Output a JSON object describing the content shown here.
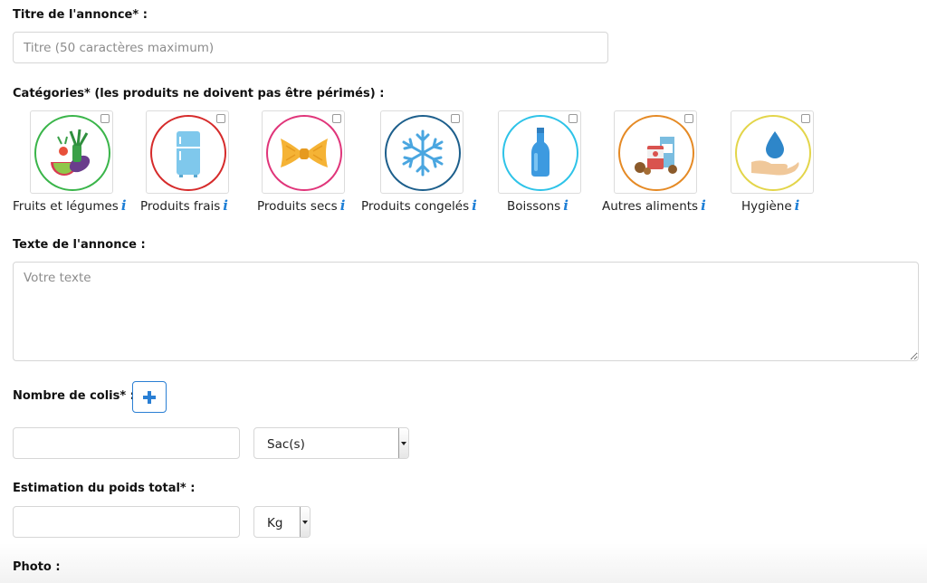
{
  "title_section": {
    "label": "Titre de l'annonce* :",
    "placeholder": "Titre (50 caractères maximum)",
    "value": ""
  },
  "categories_section": {
    "label": "Catégories* (les produits ne doivent pas être périmés) :",
    "items": [
      {
        "label": "Fruits et légumes",
        "icon": "vegetables-icon",
        "ring_color": "#3ab54a",
        "checked": false
      },
      {
        "label": "Produits frais",
        "icon": "fridge-icon",
        "ring_color": "#d62b2b",
        "checked": false
      },
      {
        "label": "Produits secs",
        "icon": "pasta-icon",
        "ring_color": "#e0357a",
        "checked": false
      },
      {
        "label": "Produits congelés",
        "icon": "snowflake-icon",
        "ring_color": "#1d5f8c",
        "checked": false
      },
      {
        "label": "Boissons",
        "icon": "bottle-icon",
        "ring_color": "#2ec3e8",
        "checked": false
      },
      {
        "label": "Autres aliments",
        "icon": "canned-food-icon",
        "ring_color": "#e58a25",
        "checked": false
      },
      {
        "label": "Hygiène",
        "icon": "water-drop-hand-icon",
        "ring_color": "#e3d54a",
        "checked": false
      }
    ],
    "info_icon": "info-icon",
    "info_color": "#1e7fd6"
  },
  "text_section": {
    "label": "Texte de l'annonce :",
    "placeholder": "Votre texte",
    "value": ""
  },
  "colis_section": {
    "label": "Nombre de colis* :",
    "add_icon": "plus-icon",
    "quantity_value": "",
    "unit_selected": "Sac(s)"
  },
  "weight_section": {
    "label": "Estimation du poids total* :",
    "value": "",
    "unit_selected": "Kg"
  },
  "photo_section": {
    "label": "Photo :"
  },
  "colors": {
    "accent": "#2a7fd4",
    "border": "#d6d6d6",
    "placeholder": "#8c8c8c"
  }
}
